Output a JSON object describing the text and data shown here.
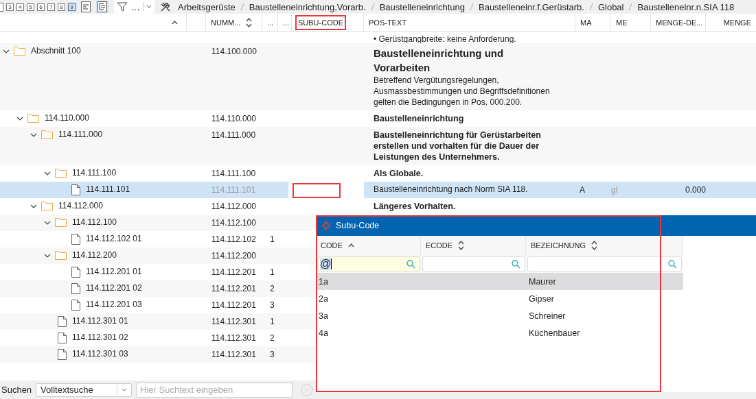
{
  "toolbar": {
    "level_buttons": [
      {
        "label": "3",
        "selected": false
      },
      {
        "label": "4",
        "selected": false
      },
      {
        "label": "5",
        "selected": false
      },
      {
        "label": "6",
        "selected": false
      },
      {
        "label": "7",
        "selected": false
      },
      {
        "label": "8",
        "selected": false
      },
      {
        "label": "9",
        "selected": true
      }
    ],
    "filter": {
      "label": "…"
    },
    "breadcrumbs": [
      "Arbeitsgerüste",
      "Baustelleneinrichtung,Vorarb.",
      "Baustelleneinrichtung",
      "Baustelleneinr.f.Gerüstarb.",
      "Global",
      "Baustelleneinr.n.SIA 118"
    ]
  },
  "table": {
    "columns": [
      {
        "kind": "sorted",
        "highlighted": false
      },
      {
        "kind": "plain",
        "highlighted": false
      },
      {
        "label": "NUMM...",
        "kind": "sortable",
        "highlighted": false
      },
      {
        "label": "...",
        "kind": "plain",
        "highlighted": false
      },
      {
        "label": "...",
        "kind": "plain",
        "highlighted": false
      },
      {
        "label": "SUBU-CODE",
        "kind": "plain",
        "highlighted": true
      },
      {
        "label": "POS-TEXT",
        "kind": "plain",
        "highlighted": false
      },
      {
        "label": "MA",
        "kind": "plain",
        "highlighted": false
      },
      {
        "label": "ME",
        "kind": "plain",
        "highlighted": false
      },
      {
        "label": "MENGE-DE...",
        "kind": "plain",
        "highlighted": false
      },
      {
        "label": "MENGE",
        "kind": "plain",
        "highlighted": false
      }
    ],
    "cut_text": "• Gerüstgangbreite: keine Anforderung.",
    "rows": [
      {
        "kind": "folder",
        "label": "Abschnitt 100",
        "number": "114.100.000",
        "expanded": true,
        "selected": false,
        "pos_text": {
          "kind": "heading",
          "title": "Baustelleneinrichtung und Vorarbeiten",
          "description": "Betreffend Vergütungsregelungen, Ausmassbestimmungen und Begriffsdefinitionen gelten die Bedingungen in Pos. 000.200."
        },
        "children": [
          {
            "kind": "folder",
            "label": "114.110.000",
            "number": "114.110.000",
            "expanded": true,
            "selected": false,
            "pos_text": {
              "kind": "bold",
              "title": "Baustelleneinrichtung"
            },
            "children": [
              {
                "kind": "folder",
                "label": "114.111.000",
                "number": "114.111.000",
                "expanded": true,
                "selected": false,
                "pos_text": {
                  "kind": "bold",
                  "title": "Baustelleneinrichtung für Gerüstarbeiten erstellen und vorhalten für die Dauer der Leistungen des Unternehmers."
                },
                "children": [
                  {
                    "kind": "folder",
                    "label": "114.111.100",
                    "number": "114.111.100",
                    "expanded": true,
                    "selected": false,
                    "pos_text": {
                      "kind": "bold",
                      "title": "Als Globale."
                    },
                    "children": [
                      {
                        "kind": "file",
                        "label": "114.111.101",
                        "number": "114.111.101",
                        "selected": true,
                        "subu_highlighted": true,
                        "pos_text": {
                          "kind": "plain",
                          "title": "Baustelleneinrichtung nach Norm SIA 118."
                        },
                        "ma": "A",
                        "me": "gl",
                        "menge_de": "0.000"
                      }
                    ]
                  }
                ]
              },
              {
                "kind": "folder",
                "label": "114.112.000",
                "number": "114.112.000",
                "expanded": true,
                "selected": false,
                "pos_text": {
                  "kind": "bold",
                  "title": "Längeres Vorhalten."
                },
                "children": [
                  {
                    "kind": "folder",
                    "label": "114.112.100",
                    "number": "114.112.100",
                    "expanded": true,
                    "selected": false,
                    "children": [
                      {
                        "kind": "file",
                        "label": "114.112.102 01",
                        "number": "114.112.102",
                        "count": "1",
                        "selected": false
                      }
                    ]
                  },
                  {
                    "kind": "folder",
                    "label": "114.112.200",
                    "number": "114.112.200",
                    "expanded": true,
                    "selected": false,
                    "children": [
                      {
                        "kind": "file",
                        "label": "114.112.201 01",
                        "number": "114.112.201",
                        "count": "1",
                        "selected": false
                      },
                      {
                        "kind": "file",
                        "label": "114.112.201 02",
                        "number": "114.112.201",
                        "count": "2",
                        "selected": false
                      },
                      {
                        "kind": "file",
                        "label": "114.112.201 03",
                        "number": "114.112.201",
                        "count": "3",
                        "selected": false
                      }
                    ]
                  },
                  {
                    "kind": "file",
                    "label": "114.112.301 01",
                    "number": "114.112.301",
                    "count": "1",
                    "selected": false
                  },
                  {
                    "kind": "file",
                    "label": "114.112.301 02",
                    "number": "114.112.301",
                    "count": "2",
                    "selected": false
                  },
                  {
                    "kind": "file",
                    "label": "114.112.301 03",
                    "number": "114.112.301",
                    "count": "3",
                    "selected": false
                  }
                ]
              }
            ]
          }
        ]
      }
    ]
  },
  "search_bar": {
    "label": "Suchen",
    "mode": "Volltextsuche",
    "placeholder": "Hier Suchtext eingeben"
  },
  "dialog": {
    "title": "Subu-Code",
    "highlighted": true,
    "columns": [
      {
        "label": "CODE",
        "kind": "sorted"
      },
      {
        "label": "ECODE",
        "kind": "sortable"
      },
      {
        "label": "BEZEICHNUNG",
        "kind": "sortable"
      }
    ],
    "filters": [
      {
        "value": "@",
        "focused": true
      },
      {
        "focused": false
      },
      {
        "focused": false
      }
    ],
    "rows": [
      {
        "code": "1a",
        "bezeichnung": "Maurer",
        "selected": true
      },
      {
        "code": "2a",
        "bezeichnung": "Gipser",
        "selected": false
      },
      {
        "code": "3a",
        "bezeichnung": "Schreiner",
        "selected": false
      },
      {
        "code": "4a",
        "bezeichnung": "Küchenbauer",
        "selected": false
      }
    ]
  }
}
